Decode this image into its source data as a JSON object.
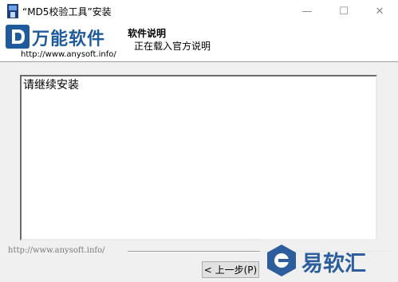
{
  "window": {
    "title": "“MD5校验工具”安装",
    "controls": {
      "minimize": "—",
      "maximize": "☐",
      "close": "✕"
    }
  },
  "header": {
    "logo_text": "万能软件",
    "logo_url": "http://www.anysoft.info/",
    "title": "软件说明",
    "subtitle": "正在载入官方说明"
  },
  "content": {
    "text": "请继续安装"
  },
  "footer": {
    "brand": "http://www.anysoft.info/",
    "back_button": "< 上一步(P)"
  },
  "watermark": {
    "text": "易软汇"
  },
  "colors": {
    "brand_blue": "#1e5a9c",
    "watermark_blue": "#2c5e9e"
  }
}
